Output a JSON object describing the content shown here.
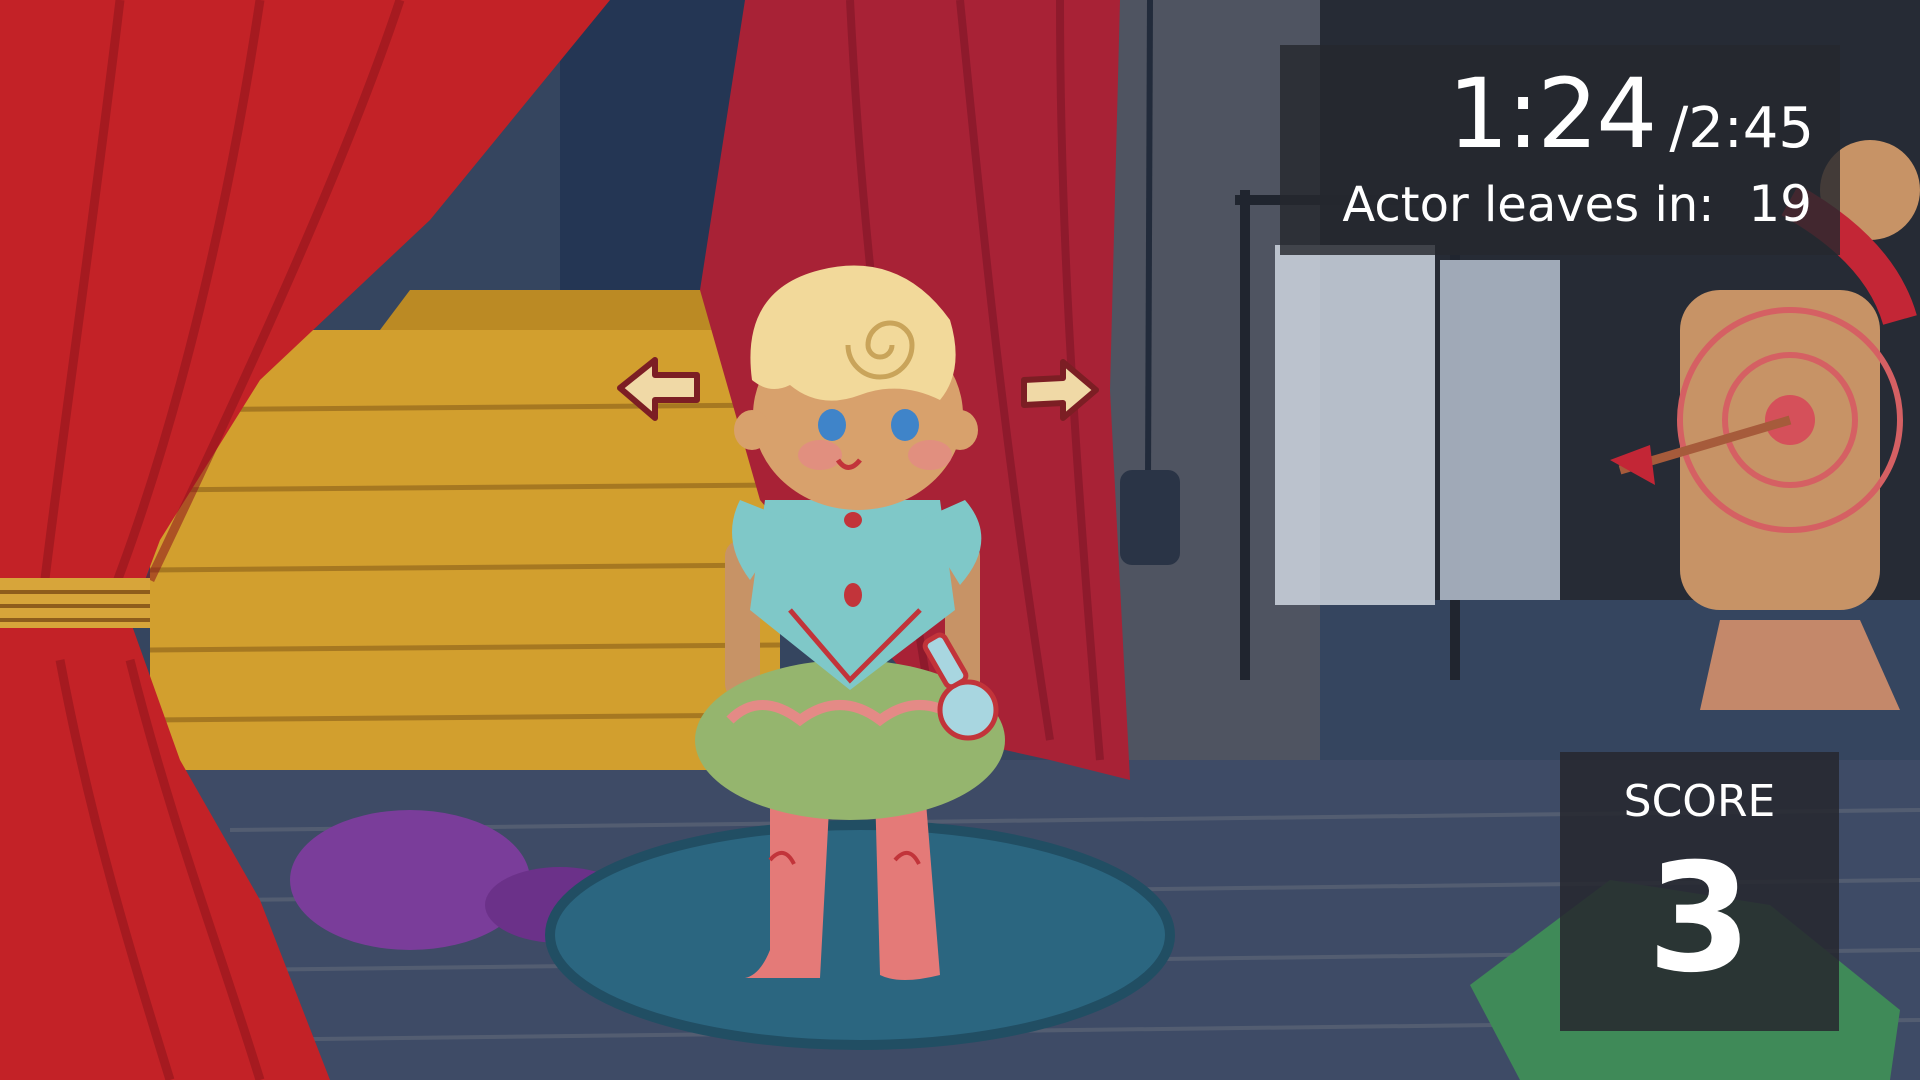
{
  "timer": {
    "elapsed": "1:24",
    "total": "/2:45"
  },
  "actor": {
    "label": "Actor leaves in:",
    "countdown": "19"
  },
  "score": {
    "label": "SCORE",
    "value": "3"
  },
  "controls": {
    "prev_icon": "left-arrow-icon",
    "next_icon": "right-arrow-icon"
  },
  "colors": {
    "curtain_red": "#b8262b",
    "stage_yellow": "#d6a12a",
    "floor_blue": "#3f4d68",
    "rug_teal": "#2f6e86",
    "hud_panel": "#26282e",
    "arrow_cream": "#f0d9a6"
  }
}
